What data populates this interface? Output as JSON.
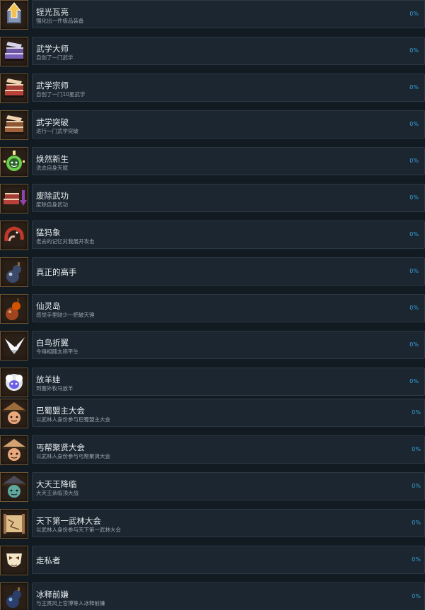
{
  "colors": {
    "background": "#121a22",
    "card": "#1b2630",
    "card_border": "#2b3945",
    "title_text": "#e8ecef",
    "desc_text": "#98a4ae",
    "percent_text": "#3aa2dc",
    "icon_frame": "#6d5534"
  },
  "achievements": [
    {
      "title": "锃光瓦亮",
      "desc": "强化出一件极品装备",
      "percent": "0%",
      "progress": 0,
      "icon": "upgrade-arrow-icon",
      "icon_colors": [
        "#f2c14e",
        "#ffffff"
      ]
    },
    {
      "title": "武学大师",
      "desc": "自创了一门武学",
      "percent": "0%",
      "progress": 0,
      "icon": "purple-book-icon",
      "icon_colors": [
        "#7a5fb8",
        "#d9d2ec"
      ]
    },
    {
      "title": "武学宗师",
      "desc": "自创了一门10星武学",
      "percent": "0%",
      "progress": 0,
      "icon": "red-book-icon",
      "icon_colors": [
        "#b8413a",
        "#f0d3b0"
      ]
    },
    {
      "title": "武学突破",
      "desc": "进行一门武学突破",
      "percent": "0%",
      "progress": 0,
      "icon": "brown-book-icon",
      "icon_colors": [
        "#a0623a",
        "#f0d3b0"
      ]
    },
    {
      "title": "焕然新生",
      "desc": "洗去自身天赋",
      "percent": "0%",
      "progress": 0,
      "icon": "reborn-face-icon",
      "icon_colors": [
        "#6ccf4a",
        "#f6e58d"
      ]
    },
    {
      "title": "废除武功",
      "desc": "废除自身武功",
      "percent": "0%",
      "progress": 0,
      "icon": "book-down-arrow-icon",
      "icon_colors": [
        "#b8413a",
        "#8e44ad"
      ]
    },
    {
      "title": "猛犸象",
      "desc": "老去的记忆对我展开攻击",
      "percent": "0%",
      "progress": 0,
      "icon": "mammoth-icon",
      "icon_colors": [
        "#c0392b",
        "#e6b8a2"
      ]
    },
    {
      "title": "真正的高手",
      "desc": "",
      "percent": "0%",
      "progress": 0,
      "icon": "gourd-bomb-icon",
      "icon_colors": [
        "#3b4a6b",
        "#dfe6e9"
      ]
    },
    {
      "title": "仙灵岛",
      "desc": "感觉手里缺少一把破天锤",
      "percent": "0%",
      "progress": 0,
      "icon": "gourd-icon",
      "icon_colors": [
        "#a0451f",
        "#d35400"
      ]
    },
    {
      "title": "白鸟折翼",
      "desc": "今得相随太称平生",
      "percent": "0%",
      "progress": 0,
      "icon": "white-bird-icon",
      "icon_colors": [
        "#f5f6fa",
        "#2d3436"
      ]
    },
    {
      "title": "放羊娃",
      "desc": "到塞外牧马放羊",
      "percent": "0%",
      "progress": 0,
      "icon": "sheep-icon",
      "icon_colors": [
        "#dfe6e9",
        "#6c5ce7"
      ]
    },
    {
      "title": "巴蜀盟主大会",
      "desc": "以武林人身份参与巴蜀盟主大会",
      "percent": "0%",
      "progress": 0,
      "icon": "hat-warrior-icon",
      "icon_colors": [
        "#9c6b3a",
        "#e8a87c"
      ]
    },
    {
      "title": "丐帮聚贤大会",
      "desc": "以武林人身份参与丐帮聚贤大会",
      "percent": "0%",
      "progress": 0,
      "icon": "straw-hat-beggar-icon",
      "icon_colors": [
        "#d4a373",
        "#e8a87c"
      ]
    },
    {
      "title": "大天王降临",
      "desc": "大天王亲临顶大战",
      "percent": "0%",
      "progress": 0,
      "icon": "heavenly-king-icon",
      "icon_colors": [
        "#4a4a5a",
        "#5fa8a0"
      ]
    },
    {
      "title": "天下第一武林大会",
      "desc": "以武林人身份参与天下第一武林大会",
      "percent": "0%",
      "progress": 0,
      "icon": "scroll-map-icon",
      "icon_colors": [
        "#a0714a",
        "#e0c08a"
      ]
    },
    {
      "title": "走私者",
      "desc": "",
      "percent": "0%",
      "progress": 0,
      "icon": "smuggler-mask-icon",
      "icon_colors": [
        "#f5e6ca",
        "#5d3a1a"
      ]
    },
    {
      "title": "冰释前嫌",
      "desc": "与王贯风上官博等人冰释前嫌",
      "percent": "0%",
      "progress": 0,
      "icon": "blue-gourd-icon",
      "icon_colors": [
        "#2c3e6b",
        "#8fd3f4"
      ]
    }
  ]
}
